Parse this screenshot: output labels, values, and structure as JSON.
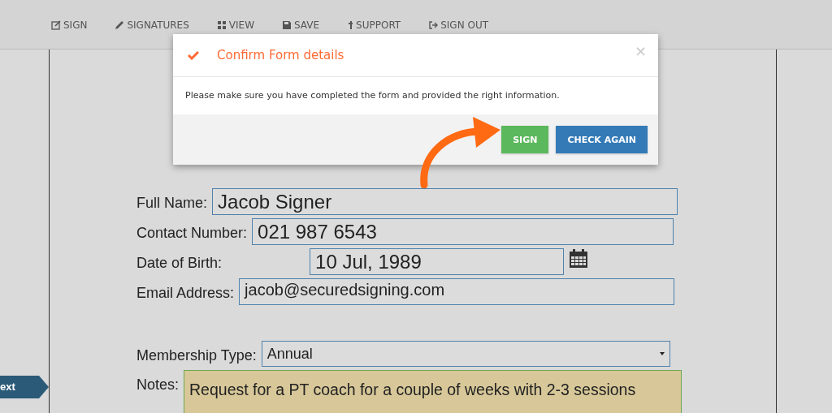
{
  "nav": {
    "items": [
      {
        "label": "SIGN",
        "kind": "edit"
      },
      {
        "label": "SIGNATURES",
        "kind": "pencil"
      },
      {
        "label": "VIEW",
        "kind": "view"
      },
      {
        "label": "SAVE",
        "kind": "save"
      },
      {
        "label": "SUPPORT",
        "kind": "support"
      },
      {
        "label": "SIGN OUT",
        "kind": "signout"
      }
    ]
  },
  "modal": {
    "title": "Confirm Form details",
    "message": "Please make sure you have completed the form and provided the right information.",
    "close": "×",
    "buttons": [
      {
        "label": "SIGN",
        "kind": "success"
      },
      {
        "label": "CHECK AGAIN",
        "kind": "primary"
      }
    ]
  },
  "form": {
    "fields": [
      {
        "label": "Full Name:",
        "value": "Jacob Signer",
        "kind": "text"
      },
      {
        "label": "Contact Number:",
        "value": "021 987 6543",
        "kind": "text"
      },
      {
        "label": "Date of Birth:",
        "value": "10 Jul, 1989",
        "kind": "date"
      },
      {
        "label": "Email Address:",
        "value": "jacob@securedsigning.com",
        "kind": "email"
      },
      {
        "label": "Membership Type:",
        "value": "Annual",
        "kind": "select"
      },
      {
        "label": "Notes:",
        "value": "Request for a PT coach for a couple of weeks with 2-3 sessions",
        "kind": "notes"
      }
    ]
  },
  "next_tab": {
    "label": "ext"
  }
}
